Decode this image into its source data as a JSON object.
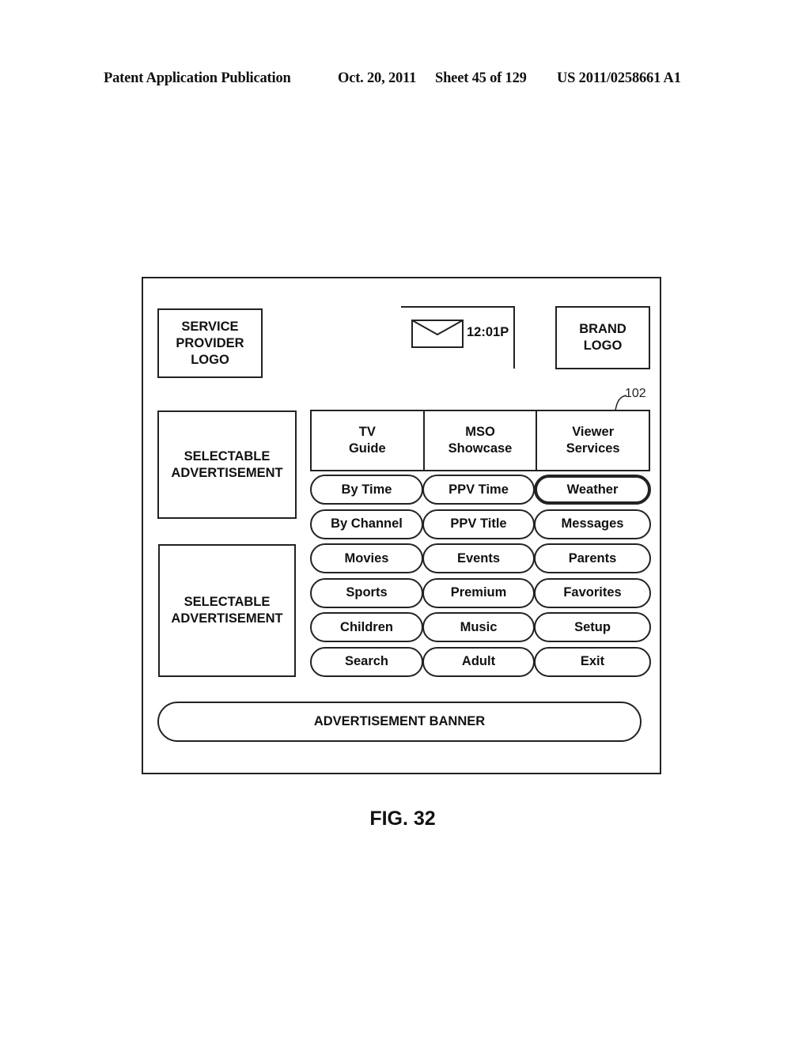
{
  "header": {
    "publication": "Patent Application Publication",
    "date": "Oct. 20, 2011",
    "sheet": "Sheet 45 of 129",
    "patent_number": "US 2011/0258661 A1"
  },
  "screen": {
    "service_provider_logo": "SERVICE PROVIDER LOGO",
    "brand_logo": "BRAND LOGO",
    "message_icon": "envelope-icon",
    "clock": "12:01P",
    "reference_numeral": "102",
    "ads": [
      {
        "label": "SELECTABLE ADVERTISEMENT"
      },
      {
        "label": "SELECTABLE ADVERTISEMENT"
      }
    ],
    "tabs": [
      {
        "label": "TV Guide"
      },
      {
        "label": "MSO Showcase"
      },
      {
        "label": "Viewer Services"
      }
    ],
    "menu": [
      {
        "label": "By Time",
        "selected": false
      },
      {
        "label": "PPV Time",
        "selected": false
      },
      {
        "label": "Weather",
        "selected": true
      },
      {
        "label": "By Channel",
        "selected": false
      },
      {
        "label": "PPV Title",
        "selected": false
      },
      {
        "label": "Messages",
        "selected": false
      },
      {
        "label": "Movies",
        "selected": false
      },
      {
        "label": "Events",
        "selected": false
      },
      {
        "label": "Parents",
        "selected": false
      },
      {
        "label": "Sports",
        "selected": false
      },
      {
        "label": "Premium",
        "selected": false
      },
      {
        "label": "Favorites",
        "selected": false
      },
      {
        "label": "Children",
        "selected": false
      },
      {
        "label": "Music",
        "selected": false
      },
      {
        "label": "Setup",
        "selected": false
      },
      {
        "label": "Search",
        "selected": false
      },
      {
        "label": "Adult",
        "selected": false
      },
      {
        "label": "Exit",
        "selected": false
      }
    ],
    "banner": "ADVERTISEMENT BANNER"
  },
  "figure_label": "FIG. 32"
}
